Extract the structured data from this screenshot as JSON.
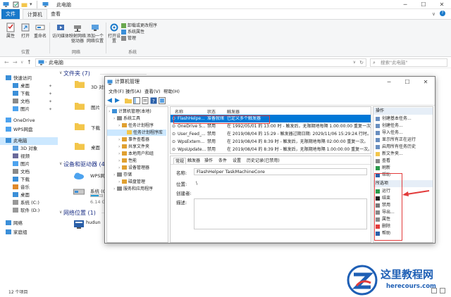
{
  "explorer": {
    "title": "此电脑",
    "tabs": [
      "文件",
      "计算机",
      "查看"
    ],
    "active_tab": "计算机",
    "ribbon": {
      "location": {
        "label": "位置",
        "items": [
          "属性",
          "打开",
          "重命名"
        ]
      },
      "network": {
        "label": "网络",
        "items": [
          "访问媒体",
          "映射网络驱动器",
          "添加一个网络位置"
        ]
      },
      "system": {
        "label": "系统",
        "open_settings": "打开设置",
        "small_items": [
          "卸载或更改程序",
          "系统属性",
          "管理"
        ]
      }
    },
    "address": "此电脑",
    "search_placeholder": "搜索\"此电脑\"",
    "nav": [
      {
        "label": "快速访问",
        "icon": "star-icon"
      },
      {
        "label": "桌面",
        "icon": "desktop-icon",
        "pinned": true
      },
      {
        "label": "下载",
        "icon": "download-icon",
        "pinned": true
      },
      {
        "label": "文档",
        "icon": "document-icon",
        "pinned": true
      },
      {
        "label": "图片",
        "icon": "picture-icon",
        "pinned": true
      },
      {
        "label": "OneDrive",
        "icon": "cloud-icon"
      },
      {
        "label": "WPS网盘",
        "icon": "cloud-icon"
      },
      {
        "label": "此电脑",
        "icon": "computer-icon",
        "selected": true
      },
      {
        "label": "3D 对象",
        "icon": "cube-icon"
      },
      {
        "label": "视频",
        "icon": "video-icon"
      },
      {
        "label": "图片",
        "icon": "picture-icon"
      },
      {
        "label": "文档",
        "icon": "document-icon"
      },
      {
        "label": "下载",
        "icon": "download-icon"
      },
      {
        "label": "音乐",
        "icon": "music-icon"
      },
      {
        "label": "桌面",
        "icon": "desktop-icon"
      },
      {
        "label": "系统 (C:)",
        "icon": "drive-icon"
      },
      {
        "label": "软件 (D:)",
        "icon": "drive-icon"
      },
      {
        "label": "网络",
        "icon": "network-icon"
      },
      {
        "label": "家庭组",
        "icon": "homegroup-icon"
      }
    ],
    "folders_section": "文件夹 (7)",
    "folders": [
      "3D 对象",
      "图片",
      "下载",
      "桌面"
    ],
    "devices_section": "设备和驱动器 (4)",
    "devices": [
      "WPS网",
      "系统 (C",
      "6.14 G"
    ],
    "netloc_section": "网络位置 (1)",
    "netloc": [
      "hudun"
    ],
    "status": "12 个项目"
  },
  "cm": {
    "title": "计算机管理",
    "menu": [
      "文件(F)",
      "操作(A)",
      "查看(V)",
      "帮助(H)"
    ],
    "tree": [
      {
        "label": "计算机管理(本地)",
        "indent": 0
      },
      {
        "label": "系统工具",
        "indent": 1
      },
      {
        "label": "任务计划程序",
        "indent": 2
      },
      {
        "label": "任务计划程序库",
        "indent": 3,
        "selected": true
      },
      {
        "label": "事件查看器",
        "indent": 2
      },
      {
        "label": "共享文件夹",
        "indent": 2
      },
      {
        "label": "本地用户和组",
        "indent": 2
      },
      {
        "label": "性能",
        "indent": 2
      },
      {
        "label": "设备管理器",
        "indent": 2
      },
      {
        "label": "存储",
        "indent": 1
      },
      {
        "label": "磁盘管理",
        "indent": 2
      },
      {
        "label": "服务和应用程序",
        "indent": 1
      }
    ],
    "list_headers": [
      "名称",
      "状态",
      "触发器"
    ],
    "rows": [
      {
        "name": "FlashHelpe...",
        "status": "准备就绪",
        "trigger": "已定义多个触发器",
        "selected": true
      },
      {
        "name": "OneDrive S...",
        "status": "禁用",
        "trigger": "在 1992/05/01 的 13:00 时 - 触发后，无限期地每隔 1.00:00:00 重复一次。"
      },
      {
        "name": "User_Feed_...",
        "status": "禁用",
        "trigger": "在 2019/08/04 的 15:29 - 触发器过期日期: 2029/11/06 15:29:24.行时。"
      },
      {
        "name": "WpsExtern...",
        "status": "禁用",
        "trigger": "在 2019/08/04 的 8:39 时 - 触发后，无限期地每隔 02:00:00 重复一次。"
      },
      {
        "name": "WpsUpdate...",
        "status": "禁用",
        "trigger": "在 2019/08/04 的 8:39 时 - 触发后，无限期地每隔 1.00:00:00 重复一次。"
      }
    ],
    "detail_tabs": [
      "常规",
      "触发器",
      "操作",
      "条件",
      "设置",
      "历史记录(已禁用)"
    ],
    "detail": {
      "name_label": "名称:",
      "name_value": "FlashHelper TaskMachineCore",
      "location_label": "位置:",
      "location_value": "\\",
      "author_label": "创建者:",
      "desc_label": "描述:"
    },
    "actions_head1": "操作",
    "actions_top": [
      {
        "label": "创建基本任务...",
        "icon": "task-icon"
      },
      {
        "label": "创建任务...",
        "icon": "task-icon"
      },
      {
        "label": "导入任务...",
        "icon": "import-icon"
      },
      {
        "label": "显示所有正在运行",
        "icon": "list-icon"
      },
      {
        "label": "启用所有任务历史",
        "icon": "history-icon"
      },
      {
        "label": "新文件夹...",
        "icon": "folder-icon"
      },
      {
        "label": "查看",
        "icon": "view-icon"
      },
      {
        "label": "刷新",
        "icon": "refresh-icon"
      },
      {
        "label": "帮助",
        "icon": "help-icon"
      }
    ],
    "actions_head2": "所选项",
    "actions_sel": [
      {
        "label": "运行",
        "icon": "run-icon"
      },
      {
        "label": "结束",
        "icon": "stop-icon"
      },
      {
        "label": "禁用",
        "icon": "disable-icon"
      },
      {
        "label": "导出...",
        "icon": "export-icon"
      },
      {
        "label": "属性",
        "icon": "properties-icon"
      },
      {
        "label": "删除",
        "icon": "delete-icon"
      },
      {
        "label": "帮助",
        "icon": "help-icon"
      }
    ]
  },
  "watermark": {
    "cn": "这里教程网",
    "url": "herecours.com"
  }
}
